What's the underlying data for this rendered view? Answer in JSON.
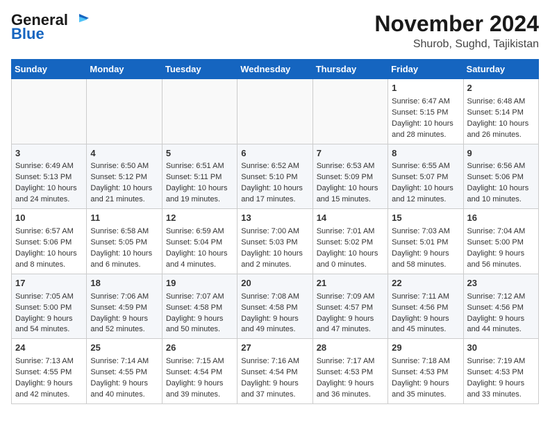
{
  "logo": {
    "general": "General",
    "blue": "Blue"
  },
  "title": "November 2024",
  "location": "Shurob, Sughd, Tajikistan",
  "days_of_week": [
    "Sunday",
    "Monday",
    "Tuesday",
    "Wednesday",
    "Thursday",
    "Friday",
    "Saturday"
  ],
  "weeks": [
    [
      {
        "day": "",
        "info": ""
      },
      {
        "day": "",
        "info": ""
      },
      {
        "day": "",
        "info": ""
      },
      {
        "day": "",
        "info": ""
      },
      {
        "day": "",
        "info": ""
      },
      {
        "day": "1",
        "info": "Sunrise: 6:47 AM\nSunset: 5:15 PM\nDaylight: 10 hours and 28 minutes."
      },
      {
        "day": "2",
        "info": "Sunrise: 6:48 AM\nSunset: 5:14 PM\nDaylight: 10 hours and 26 minutes."
      }
    ],
    [
      {
        "day": "3",
        "info": "Sunrise: 6:49 AM\nSunset: 5:13 PM\nDaylight: 10 hours and 24 minutes."
      },
      {
        "day": "4",
        "info": "Sunrise: 6:50 AM\nSunset: 5:12 PM\nDaylight: 10 hours and 21 minutes."
      },
      {
        "day": "5",
        "info": "Sunrise: 6:51 AM\nSunset: 5:11 PM\nDaylight: 10 hours and 19 minutes."
      },
      {
        "day": "6",
        "info": "Sunrise: 6:52 AM\nSunset: 5:10 PM\nDaylight: 10 hours and 17 minutes."
      },
      {
        "day": "7",
        "info": "Sunrise: 6:53 AM\nSunset: 5:09 PM\nDaylight: 10 hours and 15 minutes."
      },
      {
        "day": "8",
        "info": "Sunrise: 6:55 AM\nSunset: 5:07 PM\nDaylight: 10 hours and 12 minutes."
      },
      {
        "day": "9",
        "info": "Sunrise: 6:56 AM\nSunset: 5:06 PM\nDaylight: 10 hours and 10 minutes."
      }
    ],
    [
      {
        "day": "10",
        "info": "Sunrise: 6:57 AM\nSunset: 5:06 PM\nDaylight: 10 hours and 8 minutes."
      },
      {
        "day": "11",
        "info": "Sunrise: 6:58 AM\nSunset: 5:05 PM\nDaylight: 10 hours and 6 minutes."
      },
      {
        "day": "12",
        "info": "Sunrise: 6:59 AM\nSunset: 5:04 PM\nDaylight: 10 hours and 4 minutes."
      },
      {
        "day": "13",
        "info": "Sunrise: 7:00 AM\nSunset: 5:03 PM\nDaylight: 10 hours and 2 minutes."
      },
      {
        "day": "14",
        "info": "Sunrise: 7:01 AM\nSunset: 5:02 PM\nDaylight: 10 hours and 0 minutes."
      },
      {
        "day": "15",
        "info": "Sunrise: 7:03 AM\nSunset: 5:01 PM\nDaylight: 9 hours and 58 minutes."
      },
      {
        "day": "16",
        "info": "Sunrise: 7:04 AM\nSunset: 5:00 PM\nDaylight: 9 hours and 56 minutes."
      }
    ],
    [
      {
        "day": "17",
        "info": "Sunrise: 7:05 AM\nSunset: 5:00 PM\nDaylight: 9 hours and 54 minutes."
      },
      {
        "day": "18",
        "info": "Sunrise: 7:06 AM\nSunset: 4:59 PM\nDaylight: 9 hours and 52 minutes."
      },
      {
        "day": "19",
        "info": "Sunrise: 7:07 AM\nSunset: 4:58 PM\nDaylight: 9 hours and 50 minutes."
      },
      {
        "day": "20",
        "info": "Sunrise: 7:08 AM\nSunset: 4:58 PM\nDaylight: 9 hours and 49 minutes."
      },
      {
        "day": "21",
        "info": "Sunrise: 7:09 AM\nSunset: 4:57 PM\nDaylight: 9 hours and 47 minutes."
      },
      {
        "day": "22",
        "info": "Sunrise: 7:11 AM\nSunset: 4:56 PM\nDaylight: 9 hours and 45 minutes."
      },
      {
        "day": "23",
        "info": "Sunrise: 7:12 AM\nSunset: 4:56 PM\nDaylight: 9 hours and 44 minutes."
      }
    ],
    [
      {
        "day": "24",
        "info": "Sunrise: 7:13 AM\nSunset: 4:55 PM\nDaylight: 9 hours and 42 minutes."
      },
      {
        "day": "25",
        "info": "Sunrise: 7:14 AM\nSunset: 4:55 PM\nDaylight: 9 hours and 40 minutes."
      },
      {
        "day": "26",
        "info": "Sunrise: 7:15 AM\nSunset: 4:54 PM\nDaylight: 9 hours and 39 minutes."
      },
      {
        "day": "27",
        "info": "Sunrise: 7:16 AM\nSunset: 4:54 PM\nDaylight: 9 hours and 37 minutes."
      },
      {
        "day": "28",
        "info": "Sunrise: 7:17 AM\nSunset: 4:53 PM\nDaylight: 9 hours and 36 minutes."
      },
      {
        "day": "29",
        "info": "Sunrise: 7:18 AM\nSunset: 4:53 PM\nDaylight: 9 hours and 35 minutes."
      },
      {
        "day": "30",
        "info": "Sunrise: 7:19 AM\nSunset: 4:53 PM\nDaylight: 9 hours and 33 minutes."
      }
    ]
  ],
  "colors": {
    "header_bg": "#1565c0",
    "header_text": "#ffffff",
    "border": "#cccccc"
  }
}
